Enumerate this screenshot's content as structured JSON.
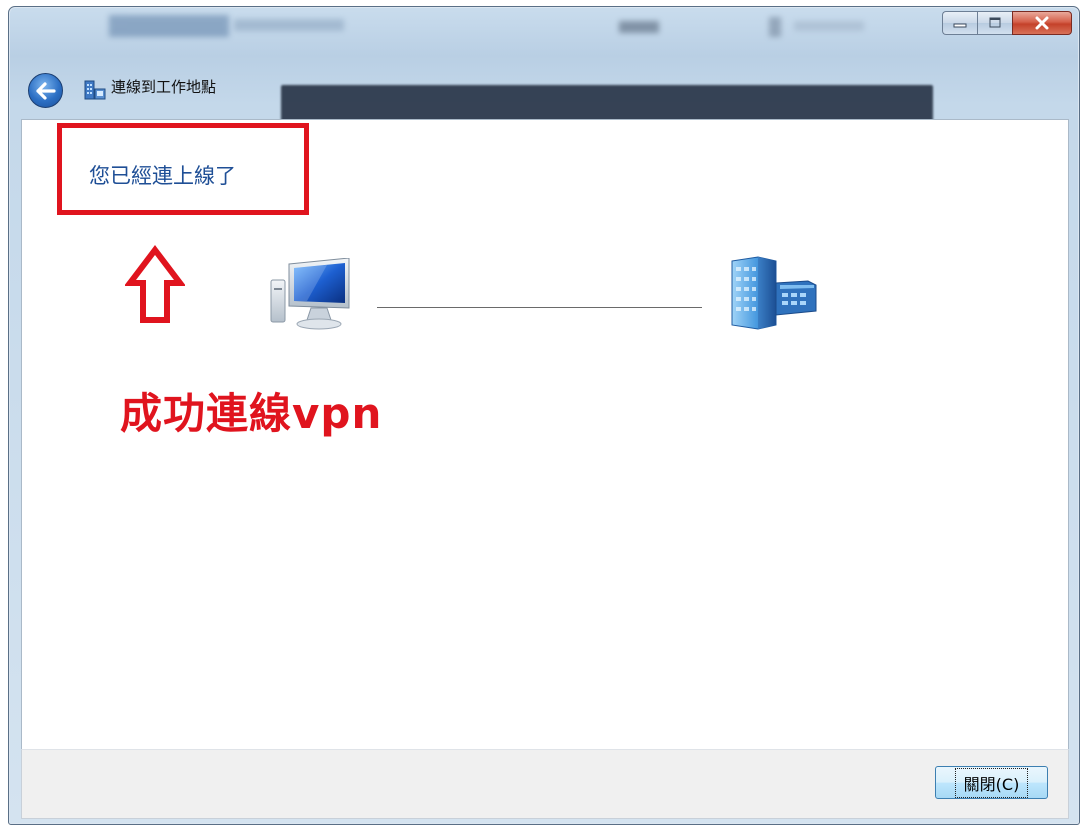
{
  "window": {
    "nav_title": "連線到工作地點",
    "controls": {
      "minimize_icon": "minimize-icon",
      "maximize_icon": "maximize-icon",
      "close_icon": "close-icon"
    },
    "back_icon": "back-arrow-icon"
  },
  "content": {
    "status_text": "您已經連上線了",
    "local_icon": "computer-icon",
    "remote_icon": "workplace-building-icon",
    "annotation_text": "成功連線vpn",
    "annotation_arrow_icon": "up-arrow-icon"
  },
  "footer": {
    "close_button_label": "關閉(C)"
  },
  "colors": {
    "annotation": "#e0141e",
    "status_text": "#1f4f96"
  }
}
